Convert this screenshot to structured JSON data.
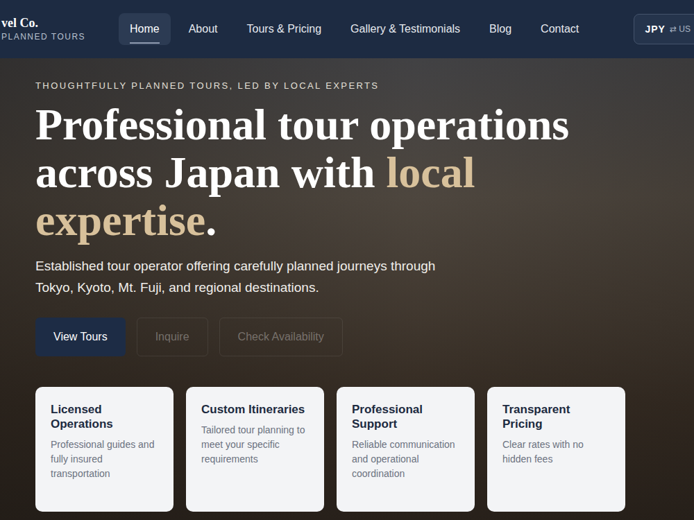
{
  "logo": {
    "name": "vel Co.",
    "tagline": "PLANNED TOURS"
  },
  "nav": [
    {
      "label": "Home",
      "selected": true
    },
    {
      "label": "About",
      "selected": false
    },
    {
      "label": "Tours & Pricing",
      "selected": false
    },
    {
      "label": "Gallery & Testimonials",
      "selected": false
    },
    {
      "label": "Blog",
      "selected": false
    },
    {
      "label": "Contact",
      "selected": false
    }
  ],
  "currency": {
    "primary": "JPY",
    "secondary": "⇄ US"
  },
  "hero": {
    "eyebrow": "THOUGHTFULLY PLANNED TOURS, LED BY LOCAL EXPERTS",
    "heading": "Professional tour operations across Japan with ",
    "highlight": "local expertise",
    "ending": ".",
    "text": "Established tour operator offering carefully planned journeys through Tokyo, Kyoto, Mt. Fuji, and regional destinations.",
    "buttons": [
      {
        "label": "View Tours",
        "kind": "primary"
      },
      {
        "label": "Inquire",
        "kind": "ghost"
      },
      {
        "label": "Check Availability",
        "kind": "ghost"
      }
    ]
  },
  "features": [
    {
      "title": "Licensed Operations",
      "text": "Professional guides and fully insured transportation"
    },
    {
      "title": "Custom Itineraries",
      "text": "Tailored tour planning to meet your specific requirements"
    },
    {
      "title": "Professional Support",
      "text": "Reliable communication and operational coordination"
    },
    {
      "title": "Transparent Pricing",
      "text": "Clear rates with no hidden fees"
    }
  ]
}
